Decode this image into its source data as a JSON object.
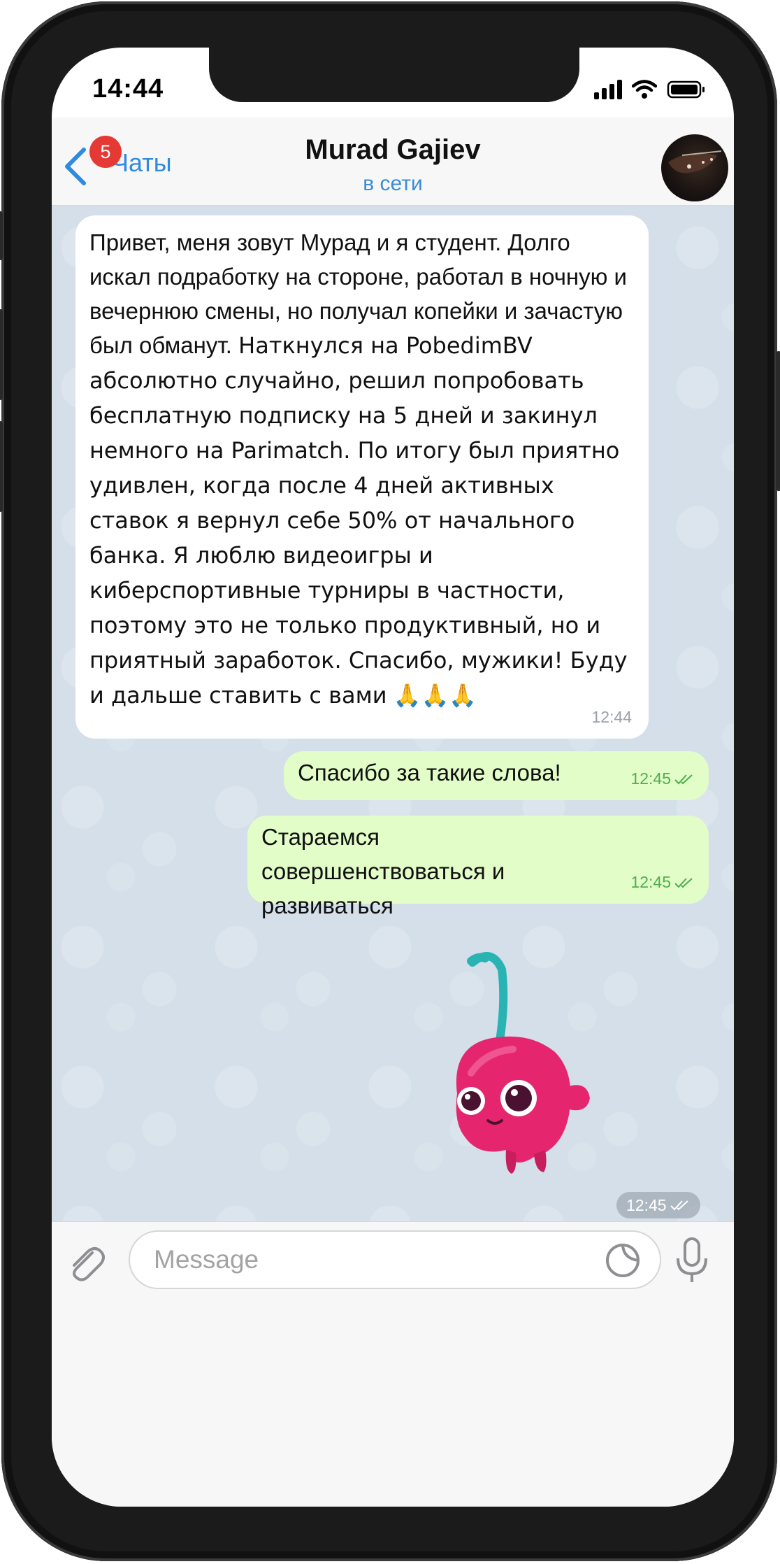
{
  "status_bar": {
    "time": "14:44"
  },
  "header": {
    "back_label": "Чаты",
    "badge_count": "5",
    "title": "Murad Gajiev",
    "subtitle": "в сети"
  },
  "messages": {
    "incoming": {
      "text_part1": "Привет, меня зовут Мурад и я студент. Долго искал подработку на стороне, работал в ночную и вечернюю смены, но получал копейки и зачастую был обманут.",
      "text_part2": "Наткнулся на PobedimBV абсолютно случайно, решил попробовать бесплатную подписку на 5 дней и закинул немного на Parimatch. По итогу был приятно удивлен, когда после 4 дней активных ставок я вернул себе 50% от начального банка. Я люблю видеоигры и киберспортивные турниры в частности, поэтому это не только продуктивный, но и приятный заработок. Спасибо, мужики! Буду и дальше ставить с вами",
      "emoji": "🙏🙏🙏",
      "time": "12:44"
    },
    "outgoing": [
      {
        "text": "Спасибо за такие слова!",
        "time": "12:45"
      },
      {
        "text": "Стараемся совершенствоваться и развиваться",
        "time": "12:45"
      }
    ],
    "sticker": {
      "name": "cherry-sticker",
      "time": "12:45"
    }
  },
  "composer": {
    "placeholder": "Message"
  },
  "colors": {
    "accent": "#2f8ae0",
    "badge": "#e53935",
    "outgoing_bubble": "#e2fdc8",
    "chat_background": "#d4dfe9"
  },
  "icons": [
    "back-chevron-icon",
    "signal-icon",
    "wifi-icon",
    "battery-icon",
    "attach-icon",
    "sticker-icon",
    "mic-icon",
    "double-check-icon"
  ]
}
